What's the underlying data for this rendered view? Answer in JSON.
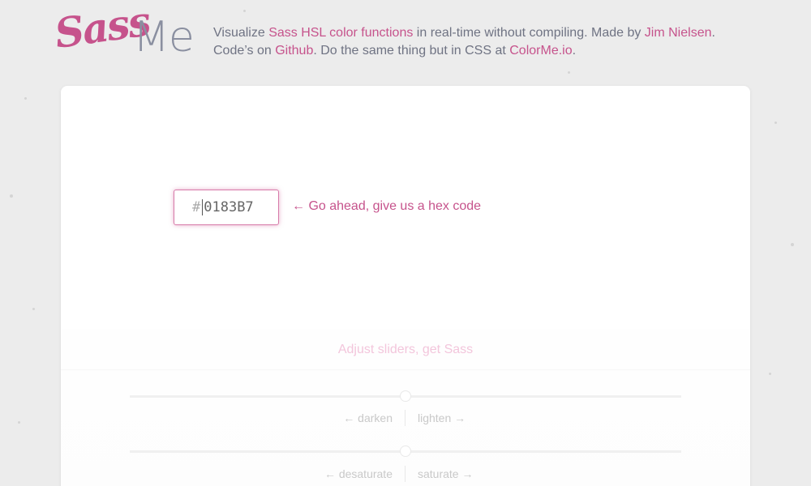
{
  "header": {
    "logo": {
      "sass": "Sass",
      "me": "Me"
    },
    "tagline": {
      "t1": "Visualize ",
      "link_sass": "Sass HSL color functions",
      "t2": " in real-time without compiling. Made by ",
      "link_author": "Jim Nielsen",
      "t3": ".",
      "t4": "Code’s on ",
      "link_github": "Github",
      "t5": ". Do the same thing but in CSS at ",
      "link_colorme": "ColorMe.io",
      "t6": "."
    }
  },
  "hex_input": {
    "hash": "#",
    "value": "0183B7"
  },
  "hint": "← Go ahead, give us a hex code",
  "adjust": {
    "title": "Adjust sliders, get Sass"
  },
  "sliders": [
    {
      "left_label": "← darken",
      "right_label": "lighten →",
      "value": 0.5
    },
    {
      "left_label": "← desaturate",
      "right_label": "saturate →",
      "value": 0.5
    }
  ],
  "colors": {
    "accent": "#c6538c",
    "muted_text": "#6f7383",
    "background": "#ececec"
  }
}
